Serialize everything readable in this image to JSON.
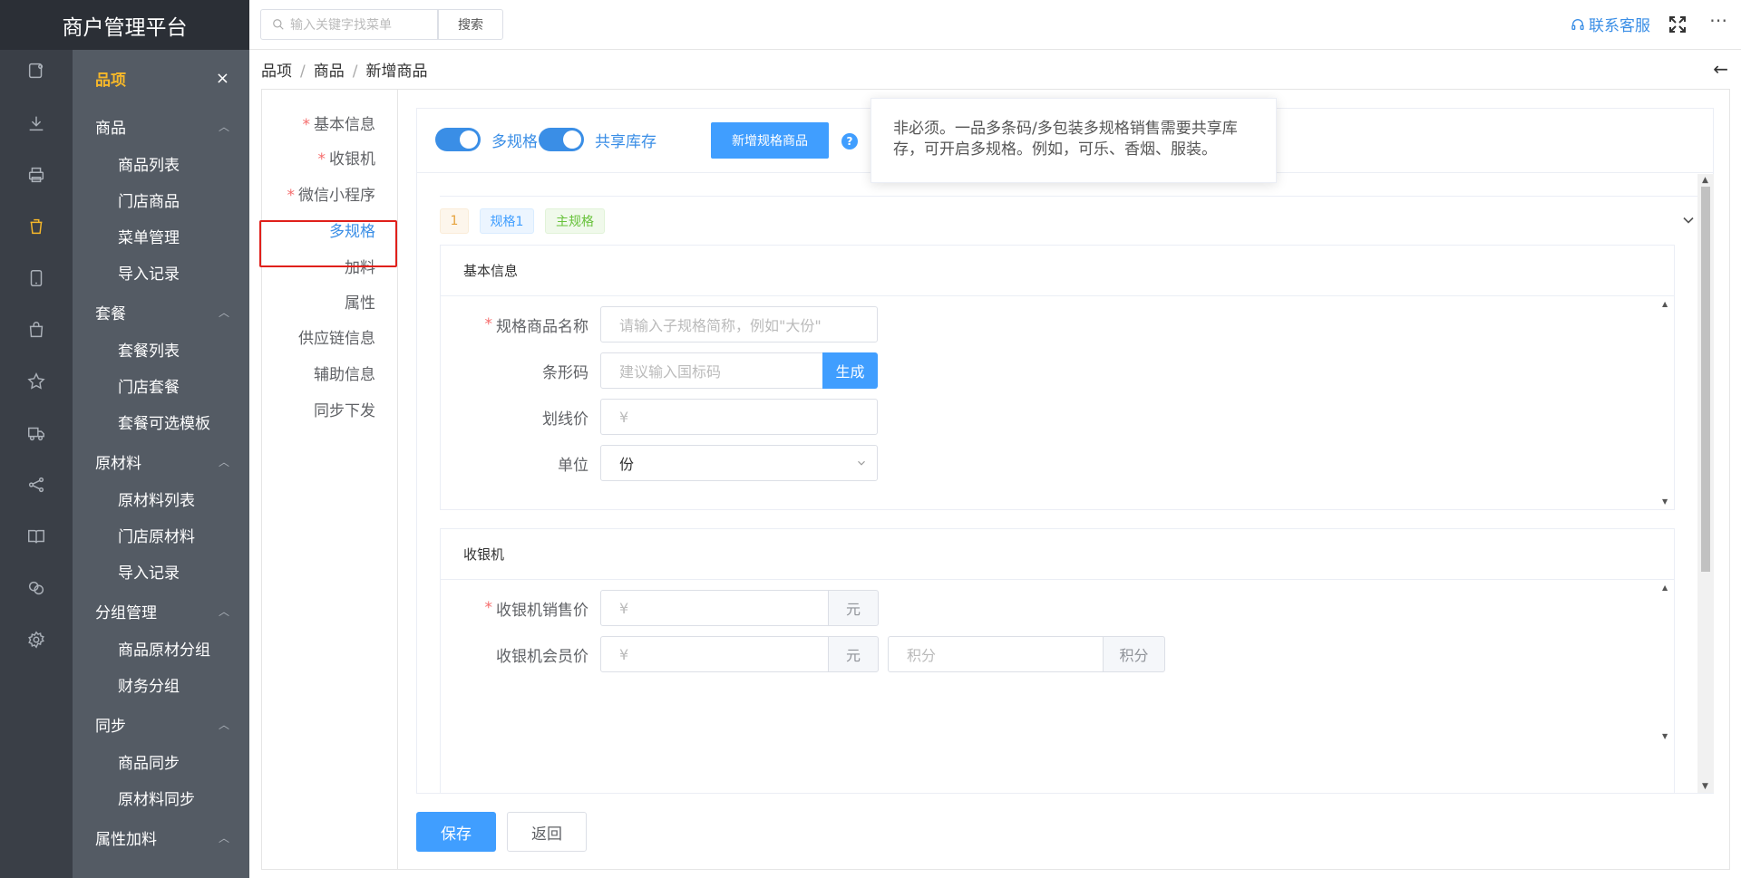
{
  "app": {
    "title": "商户管理平台"
  },
  "topbar": {
    "search_placeholder": "输入关键字找菜单",
    "search_button": "搜索",
    "service": "联系客服",
    "more": "⋯"
  },
  "sidebar_icons": [
    "sign-icon",
    "download-icon",
    "printer-icon",
    "cup-icon",
    "tablet-icon",
    "bag-icon",
    "star-icon",
    "truck-icon",
    "share-icon",
    "book-icon",
    "coupon-icon",
    "gear-icon"
  ],
  "menu": {
    "title": "品项",
    "close": "×",
    "groups": [
      {
        "label": "商品",
        "items": [
          "商品列表",
          "门店商品",
          "菜单管理",
          "导入记录"
        ]
      },
      {
        "label": "套餐",
        "items": [
          "套餐列表",
          "门店套餐",
          "套餐可选模板"
        ]
      },
      {
        "label": "原材料",
        "items": [
          "原材料列表",
          "门店原材料",
          "导入记录"
        ]
      },
      {
        "label": "分组管理",
        "items": [
          "商品原材分组",
          "财务分组"
        ]
      },
      {
        "label": "同步",
        "items": [
          "商品同步",
          "原材料同步"
        ]
      },
      {
        "label": "属性加料",
        "items": []
      }
    ]
  },
  "breadcrumb": [
    "品项",
    "商品",
    "新增商品"
  ],
  "left_nav": [
    {
      "label": "基本信息",
      "required": true
    },
    {
      "label": "收银机",
      "required": true
    },
    {
      "label": "微信小程序",
      "required": true
    },
    {
      "label": "多规格",
      "required": false,
      "active": true
    },
    {
      "label": "加料",
      "required": false
    },
    {
      "label": "属性",
      "required": false
    },
    {
      "label": "供应链信息",
      "required": false
    },
    {
      "label": "辅助信息",
      "required": false
    },
    {
      "label": "同步下发",
      "required": false
    }
  ],
  "toolbar": {
    "switch_multi": "多规格",
    "multi_on": true,
    "switch_stock": "共享库存",
    "stock_on": true,
    "add_spec_button": "新增规格商品",
    "help": "?",
    "tooltip": "非必须。一品多条码/多包装多规格销售需要共享库存，可开启多规格。例如，可乐、香烟、服装。"
  },
  "spec": {
    "tags": [
      "1",
      "规格1",
      "主规格"
    ],
    "basic": {
      "title": "基本信息",
      "name_label": "规格商品名称",
      "name_placeholder": "请输入子规格简称，例如\"大份\"",
      "barcode_label": "条形码",
      "barcode_placeholder": "建议输入国标码",
      "generate": "生成",
      "strike_label": "划线价",
      "currency": "¥",
      "unit_label": "单位",
      "unit_value": "份"
    },
    "pos": {
      "title": "收银机",
      "sale_label": "收银机销售价",
      "member_label": "收银机会员价",
      "currency": "¥",
      "yuan": "元",
      "points_placeholder": "积分",
      "points_unit": "积分"
    }
  },
  "actions": {
    "save": "保存",
    "back": "返回"
  }
}
